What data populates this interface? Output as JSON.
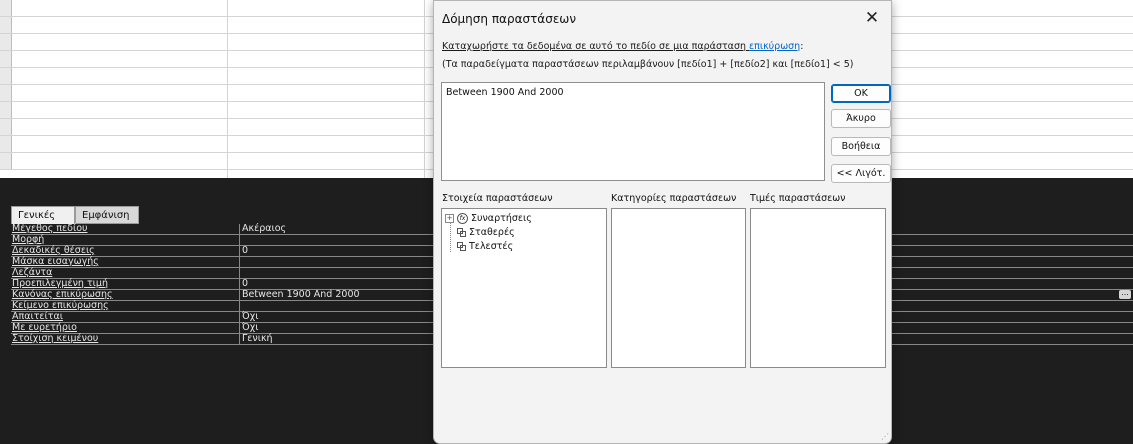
{
  "dialog": {
    "title": "Δόμηση παραστάσεων",
    "instruction_pre": "Καταχωρήστε τα δεδομένα σε αυτό το πεδίο σε μια παράσταση ",
    "instruction_link": "επικύρωση",
    "instruction_post": ":",
    "examples": "(Τα παραδείγματα παραστάσεων περιλαμβάνουν [πεδίο1] + [πεδίο2] και [πεδίο1] < 5)",
    "expression": "Between 1900 And 2000",
    "buttons": {
      "ok": "OK",
      "cancel": "Άκυρο",
      "help": "Βοήθεια",
      "less": "<< Λιγότ."
    },
    "columns": {
      "elements": "Στοιχεία παραστάσεων",
      "categories": "Κατηγορίες παραστάσεων",
      "values": "Τιμές παραστάσεων"
    },
    "tree": {
      "functions": "Συναρτήσεις",
      "constants": "Σταθερές",
      "operators": "Τελεστές"
    }
  },
  "property_sheet": {
    "tabs": [
      "Γενικές",
      "Εμφάνιση"
    ],
    "rows": [
      {
        "label": "Μέγεθος πεδίου",
        "value": "Ακέραιος"
      },
      {
        "label": "Μορφή",
        "value": ""
      },
      {
        "label": "Δεκαδικές θέσεις",
        "value": "0"
      },
      {
        "label": "Μάσκα εισαγωγής",
        "value": ""
      },
      {
        "label": "Λεζάντα",
        "value": ""
      },
      {
        "label": "Προεπιλεγμένη τιμή",
        "value": "0"
      },
      {
        "label": "Κανόνας επικύρωσης",
        "value": "Between 1900 And 2000"
      },
      {
        "label": "Κείμενο επικύρωσης",
        "value": ""
      },
      {
        "label": "Απαιτείται",
        "value": "Όχι"
      },
      {
        "label": "Με ευρετήριο",
        "value": "Όχι"
      },
      {
        "label": "Στοίχιση κειμένου",
        "value": "Γενική"
      }
    ],
    "builder_button": "..."
  },
  "colors": {
    "accent": "#0067c0",
    "link": "#0066cc",
    "pane_bg": "#1e1e1e"
  }
}
